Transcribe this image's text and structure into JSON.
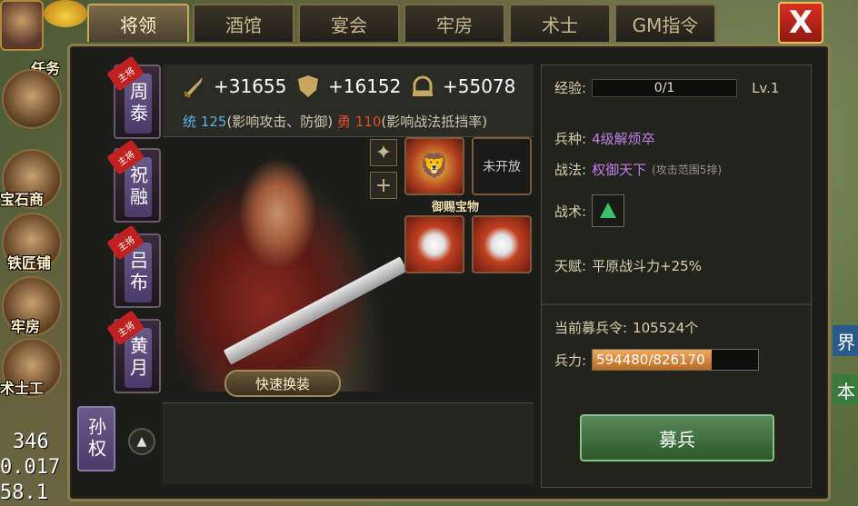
{
  "tabs": [
    {
      "label": "将领",
      "active": true
    },
    {
      "label": "酒馆",
      "active": false
    },
    {
      "label": "宴会",
      "active": false
    },
    {
      "label": "牢房",
      "active": false
    },
    {
      "label": "术士",
      "active": false
    },
    {
      "label": "GM指令",
      "active": false
    }
  ],
  "close_label": "X",
  "sidebar_left": {
    "top_label": "任务",
    "buildings": [
      "宝石商",
      "铁匠铺",
      "牢房",
      "术士工"
    ],
    "numbers": [
      "346",
      "0.017",
      "58.1"
    ]
  },
  "generals": [
    {
      "badge": "主将",
      "name": "周泰"
    },
    {
      "badge": "主将",
      "name": "祝融"
    },
    {
      "badge": "主将",
      "name": "吕布"
    },
    {
      "badge": "主将",
      "name": "黄月"
    }
  ],
  "current_general": {
    "name": "孙权"
  },
  "stats": {
    "attack": "+31655",
    "defense": "+16152",
    "power": "+55078",
    "lead_label": "统",
    "lead_value": "125",
    "lead_note": "(影响攻击、防御)",
    "brave_label": "勇",
    "brave_value": "110",
    "brave_note": "(影响战法抵挡率)"
  },
  "equipment": {
    "locked_label": "未开放",
    "imperial_label": "御赐宝物",
    "add_label": "+"
  },
  "swap_button": "快速换装",
  "info": {
    "exp_label": "经验:",
    "exp_value": "0/1",
    "level": "Lv.1",
    "troop_type_label": "兵种:",
    "troop_type_value": "4级解烦卒",
    "tactic_label": "战法:",
    "tactic_value": "权御天下",
    "tactic_note": "(攻击范围5排)",
    "skill_label": "战术:",
    "talent_label": "天赋:",
    "talent_value": "平原战斗力+25%",
    "recruit_token_label": "当前募兵令:",
    "recruit_token_value": "105524个",
    "troops_label": "兵力:",
    "troops_value": "594480/826170",
    "troops_fill": 0.72,
    "recruit_button": "募兵"
  },
  "edge_labels": [
    "界",
    "本"
  ],
  "colors": {
    "accent": "#c8a860",
    "purple": "#c080e8",
    "blue": "#5ab0e8",
    "red": "#e04a2a"
  }
}
